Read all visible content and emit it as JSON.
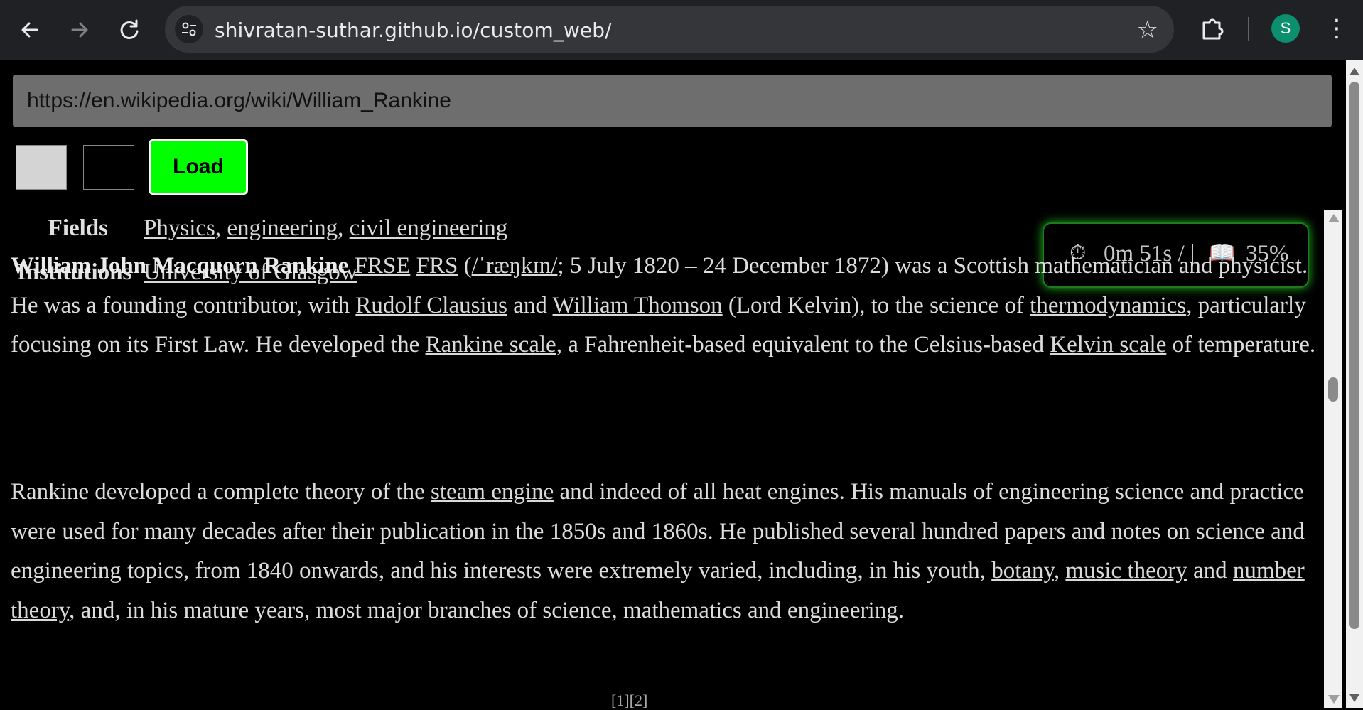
{
  "browser": {
    "url": "shivratan-suthar.github.io/custom_web/",
    "profile_initial": "S",
    "icons": {
      "back": "arrow-left-icon",
      "forward": "arrow-right-icon",
      "reload": "reload-icon",
      "site_info": "tune-icon",
      "bookmark": "star-icon",
      "extensions": "puzzle-icon",
      "menu": "kebab-menu-icon"
    },
    "colors": {
      "chrome_bg": "#202124",
      "omnibox_bg": "#35363a",
      "avatar_bg": "#0b8f6e"
    }
  },
  "controls": {
    "url_input_value": "https://en.wikipedia.org/wiki/William_Rankine",
    "load_label": "Load",
    "theme_swatches": [
      "light",
      "dark"
    ],
    "colors": {
      "load_bg": "#00ff00"
    }
  },
  "infobox": {
    "fields_label": "Fields",
    "fields_links": [
      "Physics",
      "engineering",
      "civil engineering"
    ],
    "institutions_label": "Institutions",
    "institutions_link": "University of Glasgow"
  },
  "timer": {
    "clock_icon": "stopwatch-icon",
    "time": "0m 51s / |",
    "book_icon": "open-book-icon",
    "progress": "35%",
    "progress_value": 0.35
  },
  "article": {
    "p1": {
      "name_bold": "William John Macquorn Rankine",
      "frse": "FRSE",
      "frs": "FRS",
      "ipa_open": "(",
      "ipa": "/ˈræŋkɪn/",
      "dates": "; 5 July 1820 – 24 December 1872) was a Scottish mathematician and physicist. He was a founding contributor, with ",
      "clausius": "Rudolf Clausius",
      "and1": " and ",
      "thomson": "William Thomson",
      "kelvin_text": " (Lord Kelvin), to the science of ",
      "thermo": "thermodynamics",
      "focus": ", particularly focusing on its First Law. He developed the ",
      "rankine_scale": "Rankine scale",
      "equiv": ", a Fahrenheit-based equivalent to the Celsius-based ",
      "kelvin_scale": "Kelvin scale",
      "end": " of temperature."
    },
    "p2": {
      "start": "Rankine developed a complete theory of the ",
      "steam": "steam engine",
      "mid": " and indeed of all heat engines. His manuals of engineering science and practice were used for many decades after their publication in the 1850s and 1860s. He published several hundred papers and notes on science and engineering topics, from 1840 onwards, and his interests were extremely varied, including, in his youth, ",
      "botany": "botany",
      "comma": ",",
      "music": "music theory",
      "and2": " and ",
      "number": "number theory",
      "end": ", and, in his mature years, most major branches of science, mathematics and engineering."
    },
    "cutoff_refs": "[1][2]"
  }
}
